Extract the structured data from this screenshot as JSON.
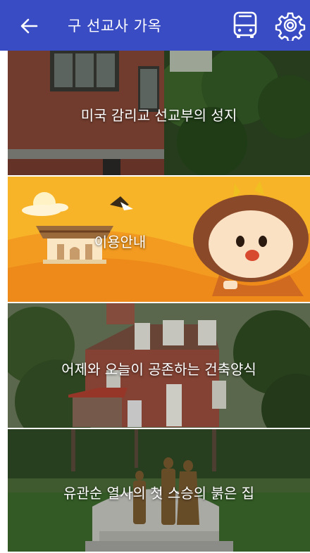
{
  "appbar": {
    "title": "구 선교사 가옥",
    "back_icon": "arrow-left-icon",
    "bus_icon": "bus-icon",
    "settings_icon": "gear-icon",
    "color": "#3a4cc3"
  },
  "menu": [
    {
      "label": "미국 감리교 선교부의 성지"
    },
    {
      "label": "이용안내"
    },
    {
      "label": "어제와 오늘이 공존하는 건축양식"
    },
    {
      "label": "유관순 열사의 첫 스승의 붉은 집"
    }
  ]
}
